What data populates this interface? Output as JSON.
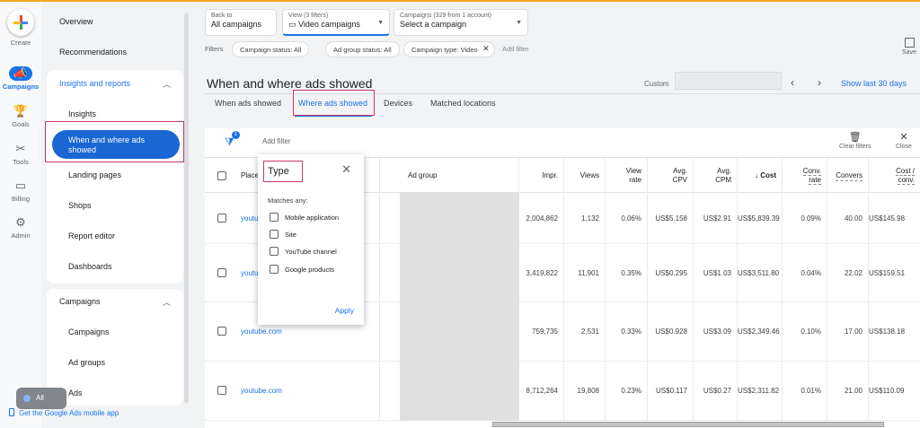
{
  "rail": {
    "create": "Create",
    "campaigns": "Campaigns",
    "goals": "Goals",
    "tools": "Tools",
    "billing": "Billing",
    "admin": "Admin"
  },
  "nav": {
    "overview": "Overview",
    "recommendations": "Recommendations",
    "insights_header": "Insights and reports",
    "insights": "Insights",
    "when_where_line1": "When and where ads",
    "when_where_line2": "showed",
    "landing_pages": "Landing pages",
    "shops": "Shops",
    "report_editor": "Report editor",
    "dashboards": "Dashboards",
    "campaigns_header": "Campaigns",
    "campaigns": "Campaigns",
    "ad_groups": "Ad groups",
    "ads": "Ads",
    "mobile_app": "Get the Google Ads mobile app",
    "floating_label": "All"
  },
  "header": {
    "back_label": "Back to",
    "back_value": "All campaigns",
    "view_label": "View (3 filters)",
    "view_value": "Video campaigns",
    "campaigns_label": "Campaigns (329 from 1 account)",
    "campaigns_value": "Select a campaign",
    "filters_label": "Filters",
    "filter_chips": [
      "Campaign status: All",
      "Ad group status: All",
      "Campaign type: Video"
    ],
    "add_filter": "Add filter",
    "save": "Save"
  },
  "page": {
    "title": "When and where ads showed",
    "custom": "Custom",
    "show_last": "Show last 30 days"
  },
  "tabs": [
    "When ads showed",
    "Where ads showed",
    "Devices",
    "Matched locations"
  ],
  "toolbar": {
    "badge": "1",
    "add_filter": "Add filter",
    "clear_filters": "Clear filters",
    "close": "Close"
  },
  "table": {
    "columns": {
      "placement": "Place",
      "ad_group": "Ad group",
      "impr": "Impr.",
      "views": "Views",
      "view_rate_1": "View",
      "view_rate_2": "rate",
      "avg_cpv_1": "Avg.",
      "avg_cpv_2": "CPV",
      "avg_cpm_1": "Avg.",
      "avg_cpm_2": "CPM",
      "cost": "↓ Cost",
      "conv_rate_1": "Conv.",
      "conv_rate_2": "rate",
      "conversions": "Convers",
      "cost_conv_1": "Cost /",
      "cost_conv_2": "conv."
    },
    "rows": [
      {
        "placement": "youtu",
        "impr": "2,004,862",
        "views": "1,132",
        "view_rate": "0.06%",
        "avg_cpv": "US$5.158",
        "avg_cpm": "US$2.91",
        "cost": "US$5,839.39",
        "conv_rate": "0.09%",
        "conversions": "40.00",
        "cost_conv": "US$145.98"
      },
      {
        "placement": "youtu",
        "impr": "3,419,822",
        "views": "11,901",
        "view_rate": "0.35%",
        "avg_cpv": "US$0.295",
        "avg_cpm": "US$1.03",
        "cost": "US$3,511.80",
        "conv_rate": "0.04%",
        "conversions": "22.02",
        "cost_conv": "US$159.51"
      },
      {
        "placement": "youtube.com",
        "impr": "759,735",
        "views": "2,531",
        "view_rate": "0.33%",
        "avg_cpv": "US$0.928",
        "avg_cpm": "US$3.09",
        "cost": "US$2,349.46",
        "conv_rate": "0.10%",
        "conversions": "17.00",
        "cost_conv": "US$138.18"
      },
      {
        "placement": "youtube.com",
        "impr": "8,712,264",
        "views": "19,808",
        "view_rate": "0.23%",
        "avg_cpv": "US$0.117",
        "avg_cpm": "US$0.27",
        "cost": "US$2,311.82",
        "conv_rate": "0.01%",
        "conversions": "21.00",
        "cost_conv": "US$110.09"
      }
    ]
  },
  "popup": {
    "title": "Type",
    "matches": "Matches any:",
    "options": [
      "Mobile application",
      "Site",
      "YouTube channel",
      "Google products"
    ],
    "apply": "Apply"
  }
}
